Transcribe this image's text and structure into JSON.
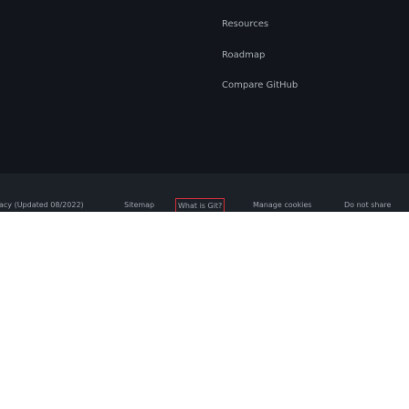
{
  "footer": {
    "links": {
      "resources": "Resources",
      "roadmap": "Roadmap",
      "compare": "Compare GitHub"
    },
    "legal": {
      "privacy": "acy (Updated 08/2022)",
      "sitemap": "Sitemap",
      "what_is_git": "What is Git?",
      "manage_cookies": "Manage cookies",
      "do_not_share": "Do not share"
    }
  },
  "colors": {
    "footer_bg": "#12151b",
    "footer_bottom_bg": "#1c2027",
    "link_text": "#a9b0b7",
    "highlight_border": "#d32f3a"
  }
}
